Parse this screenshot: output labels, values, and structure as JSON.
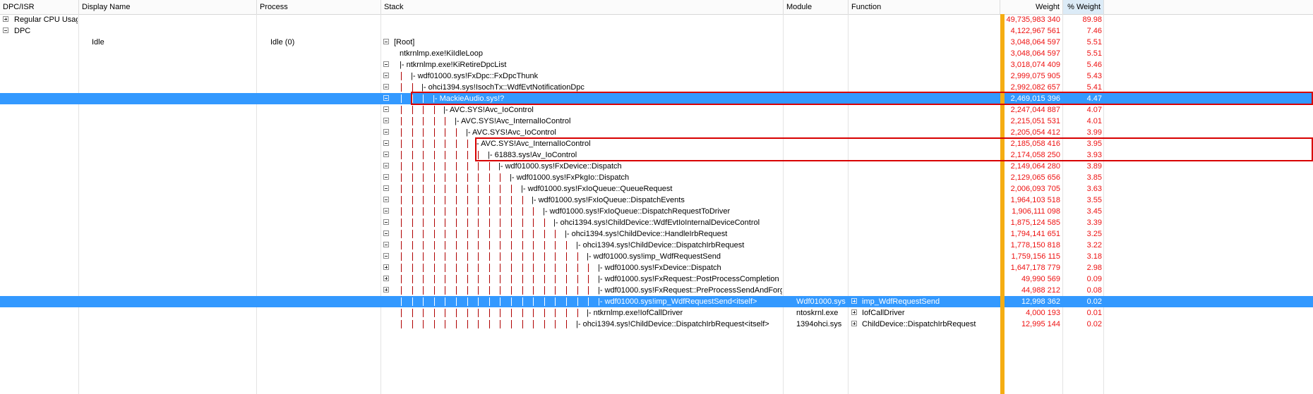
{
  "header": {
    "columns": [
      {
        "key": "dpc",
        "label": "DPC/ISR"
      },
      {
        "key": "display",
        "label": "Display Name"
      },
      {
        "key": "process",
        "label": "Process"
      },
      {
        "key": "stack",
        "label": "Stack"
      },
      {
        "key": "module",
        "label": "Module"
      },
      {
        "key": "function",
        "label": "Function"
      },
      {
        "key": "weight",
        "label": "Weight"
      },
      {
        "key": "pct",
        "label": "% Weight"
      }
    ]
  },
  "colors": {
    "selection": "#3399ff",
    "weight_text": "#ee1111",
    "highlight_box": "#d80000",
    "bar": "#f5ad12"
  },
  "rows": [
    {
      "dpc": "Regular CPU Usage",
      "dpc_exp": "plus",
      "weight": "49,735,983 340",
      "pct": "89.98"
    },
    {
      "dpc": "DPC",
      "dpc_exp": "minus",
      "weight": "4,122,967 561",
      "pct": "7.46"
    },
    {
      "display": "Idle",
      "process": "Idle (0)",
      "stack": "[Root]",
      "stack_exp": "minus",
      "depth": 0,
      "weight": "3,048,064 597",
      "pct": "5.51"
    },
    {
      "stack": "ntkrnlmp.exe!KiIdleLoop",
      "stack_exp": "",
      "depth": 0,
      "weight": "3,048,064 597",
      "pct": "5.51"
    },
    {
      "stack": "|- ntkrnlmp.exe!KiRetireDpcList",
      "stack_exp": "minus",
      "depth": 1,
      "weight": "3,018,074 409",
      "pct": "5.46"
    },
    {
      "stack": "|- wdf01000.sys!FxDpc::FxDpcThunk",
      "stack_exp": "minus",
      "depth": 2,
      "weight": "2,999,075 905",
      "pct": "5.43"
    },
    {
      "stack": "|- ohci1394.sys!IsochTx::WdfEvtNotificationDpc",
      "stack_exp": "minus",
      "depth": 3,
      "weight": "2,992,082 657",
      "pct": "5.41"
    },
    {
      "stack": "|- MackieAudio.sys!?",
      "stack_exp": "minus",
      "depth": 4,
      "weight": "2,469,015 396",
      "pct": "4.47",
      "selected": true
    },
    {
      "stack": "|- AVC.SYS!Avc_IoControl",
      "stack_exp": "minus",
      "depth": 5,
      "weight": "2,247,044 887",
      "pct": "4.07"
    },
    {
      "stack": "|- AVC.SYS!Avc_InternalIoControl",
      "stack_exp": "minus",
      "depth": 6,
      "weight": "2,215,051 531",
      "pct": "4.01"
    },
    {
      "stack": "|- AVC.SYS!Avc_IoControl",
      "stack_exp": "minus",
      "depth": 7,
      "weight": "2,205,054 412",
      "pct": "3.99"
    },
    {
      "stack": "- AVC.SYS!Avc_InternalIoControl",
      "stack_exp": "minus",
      "depth": 8,
      "weight": "2,185,058 416",
      "pct": "3.95"
    },
    {
      "stack": "|- 61883.sys!Av_IoControl",
      "stack_exp": "minus",
      "depth": 9,
      "weight": "2,174,058 250",
      "pct": "3.93"
    },
    {
      "stack": "|- wdf01000.sys!FxDevice::Dispatch",
      "stack_exp": "minus",
      "depth": 10,
      "weight": "2,149,064 280",
      "pct": "3.89"
    },
    {
      "stack": "|- wdf01000.sys!FxPkgIo::Dispatch",
      "stack_exp": "minus",
      "depth": 11,
      "weight": "2,129,065 656",
      "pct": "3.85"
    },
    {
      "stack": "|- wdf01000.sys!FxIoQueue::QueueRequest",
      "stack_exp": "minus",
      "depth": 12,
      "weight": "2,006,093 705",
      "pct": "3.63"
    },
    {
      "stack": "|- wdf01000.sys!FxIoQueue::DispatchEvents",
      "stack_exp": "minus",
      "depth": 13,
      "weight": "1,964,103 518",
      "pct": "3.55"
    },
    {
      "stack": "|- wdf01000.sys!FxIoQueue::DispatchRequestToDriver",
      "stack_exp": "minus",
      "depth": 14,
      "weight": "1,906,111 098",
      "pct": "3.45"
    },
    {
      "stack": "|- ohci1394.sys!ChildDevice::WdfEvtIoInternalDeviceControl",
      "stack_exp": "minus",
      "depth": 15,
      "weight": "1,875,124 585",
      "pct": "3.39"
    },
    {
      "stack": "|- ohci1394.sys!ChildDevice::HandleIrbRequest",
      "stack_exp": "minus",
      "depth": 16,
      "weight": "1,794,141 651",
      "pct": "3.25"
    },
    {
      "stack": "|- ohci1394.sys!ChildDevice::DispatchIrbRequest",
      "stack_exp": "minus",
      "depth": 17,
      "weight": "1,778,150 818",
      "pct": "3.22"
    },
    {
      "stack": "|- wdf01000.sys!imp_WdfRequestSend",
      "stack_exp": "minus",
      "depth": 18,
      "weight": "1,759,156 115",
      "pct": "3.18"
    },
    {
      "stack": "|- wdf01000.sys!FxDevice::Dispatch",
      "stack_exp": "plus",
      "depth": 19,
      "weight": "1,647,178 779",
      "pct": "2.98"
    },
    {
      "stack": "|- wdf01000.sys!FxRequest::PostProcessCompletion",
      "stack_exp": "plus",
      "depth": 19,
      "weight": "49,990 569",
      "pct": "0.09"
    },
    {
      "stack": "|- wdf01000.sys!FxRequest::PreProcessSendAndForget",
      "stack_exp": "plus",
      "depth": 19,
      "weight": "44,988 212",
      "pct": "0.08"
    },
    {
      "stack": "|- wdf01000.sys!imp_WdfRequestSend<itself>",
      "stack_exp": "",
      "depth": 19,
      "module": "Wdf01000.sys",
      "function": "imp_WdfRequestSend",
      "function_exp": "plus",
      "weight": "12,998 362",
      "pct": "0.02",
      "selected": true
    },
    {
      "stack": "|- ntkrnlmp.exe!IofCallDriver",
      "stack_exp": "",
      "depth": 18,
      "module": "ntoskrnl.exe",
      "function": "IofCallDriver",
      "function_exp": "plus",
      "weight": "4,000 193",
      "pct": "0.01"
    },
    {
      "stack": "|- ohci1394.sys!ChildDevice::DispatchIrbRequest<itself>",
      "stack_exp": "",
      "depth": 17,
      "module": "1394ohci.sys",
      "function": "ChildDevice::DispatchIrbRequest",
      "function_exp": "plus",
      "weight": "12,995 144",
      "pct": "0.02"
    }
  ]
}
